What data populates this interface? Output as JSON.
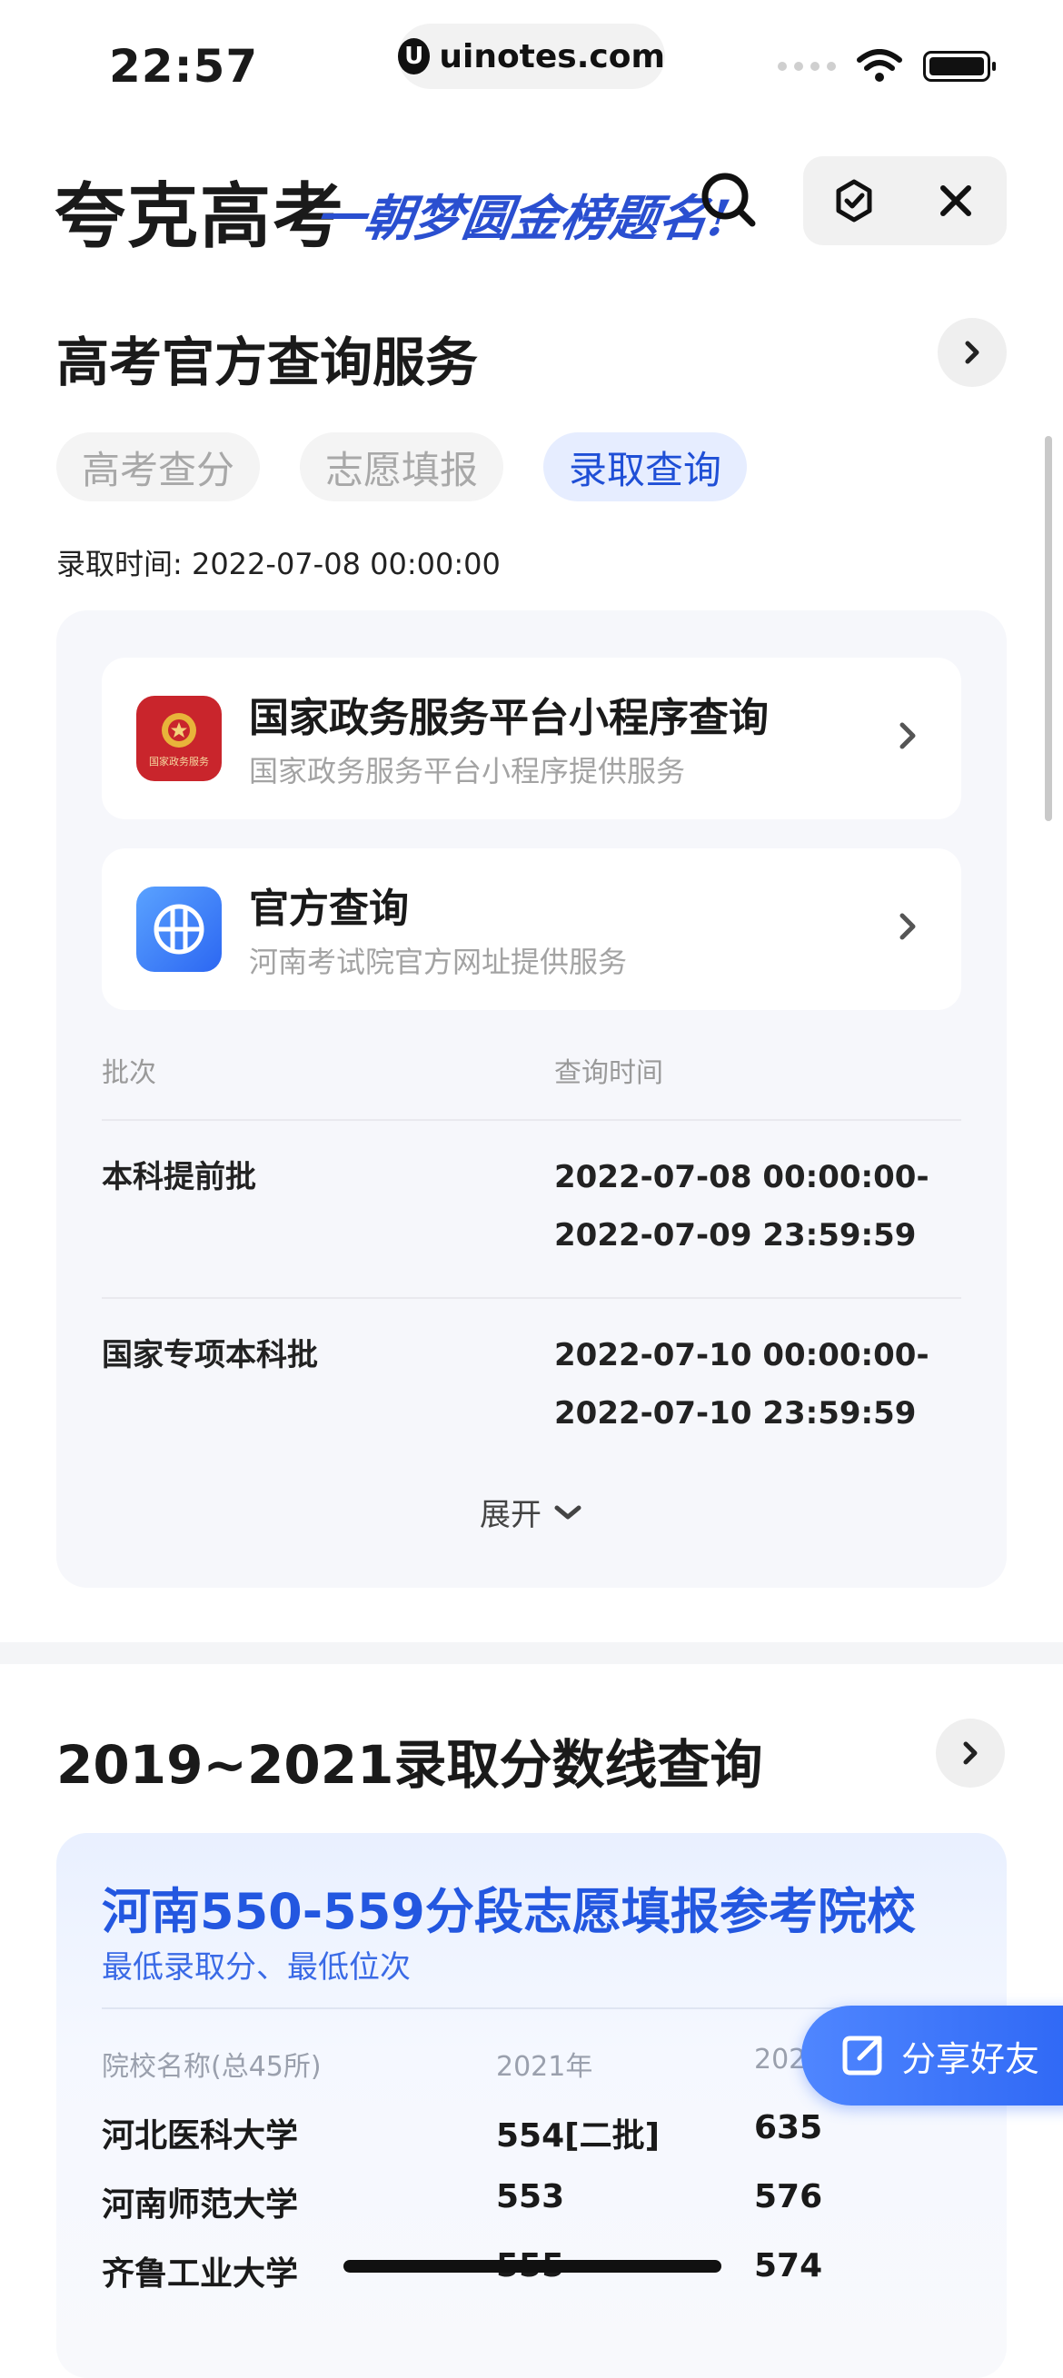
{
  "status_bar": {
    "time": "22:57",
    "url": "uinotes.com",
    "url_logo_letter": "U",
    "icons": [
      "signal-dots-icon",
      "wifi-icon",
      "battery-icon"
    ]
  },
  "header": {
    "brand": "夸克高考",
    "slogan": "一朝梦圆金榜题名!",
    "icons": [
      "search-icon",
      "refresh-icon",
      "close-icon"
    ]
  },
  "official_service": {
    "title": "高考官方查询服务",
    "tabs": [
      {
        "label": "高考查分",
        "active": false
      },
      {
        "label": "志愿填报",
        "active": false
      },
      {
        "label": "录取查询",
        "active": true
      }
    ],
    "admission_time": "录取时间: 2022-07-08 00:00:00",
    "cards": [
      {
        "title": "国家政务服务平台小程序查询",
        "subtitle": "国家政务服务平台小程序提供服务",
        "icon": "national-emblem-icon",
        "icon_caption": "国家政务服务"
      },
      {
        "title": "官方查询",
        "subtitle": "河南考试院官方网址提供服务",
        "icon": "globe-icon"
      }
    ],
    "table": {
      "headers": [
        "批次",
        "查询时间"
      ],
      "rows": [
        {
          "batch": "本科提前批",
          "time_start": "2022-07-08 00:00:00-",
          "time_end": "2022-07-09 23:59:59"
        },
        {
          "batch": "国家专项本科批",
          "time_start": "2022-07-10 00:00:00-",
          "time_end": "2022-07-10 23:59:59"
        }
      ]
    },
    "expand_label": "展开"
  },
  "score_line": {
    "title": "2019~2021录取分数线查询",
    "panel_title": "河南550-559分段志愿填报参考院校",
    "panel_subtitle": "最低录取分、最低位次",
    "headers": [
      "院校名称(总45所)",
      "2021年",
      "202"
    ],
    "rows": [
      {
        "name": "河北医科大学",
        "y2021": "554[二批]",
        "y2020": "635"
      },
      {
        "name": "河南师范大学",
        "y2021": "553",
        "y2020": "576"
      },
      {
        "name": "齐鲁工业大学",
        "y2021": "555",
        "y2020": "574"
      }
    ]
  },
  "share_button": {
    "label": "分享好友",
    "icon": "share-icon"
  },
  "colors": {
    "accent": "#2357e0",
    "tab_active_bg": "#e6edff",
    "share_bg": "#3b74f8"
  }
}
